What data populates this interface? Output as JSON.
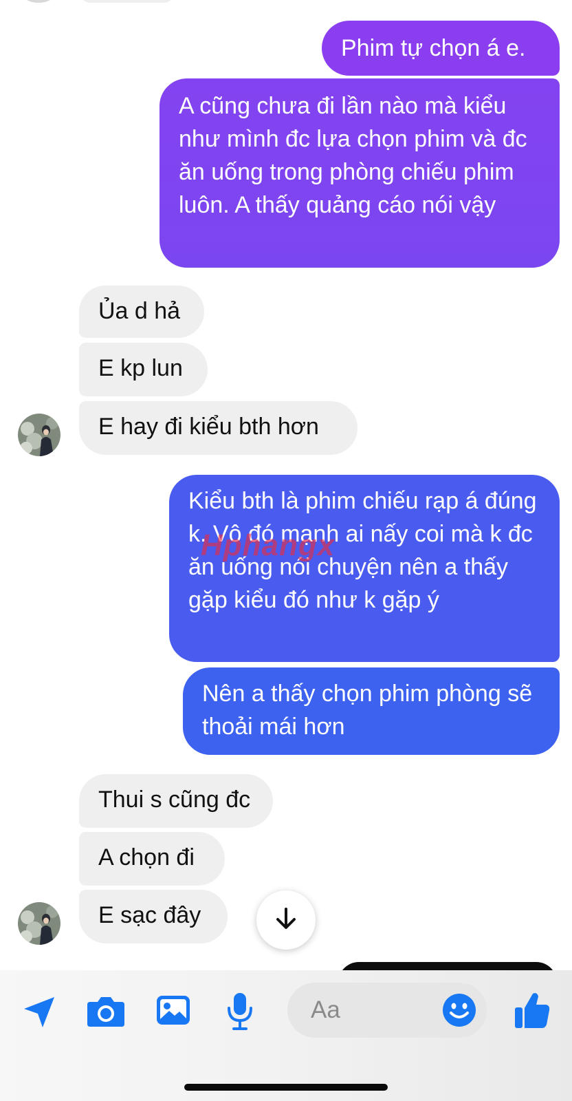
{
  "conversation": {
    "messages": [
      {
        "sender": "me",
        "text": "Phim tự chọn á e."
      },
      {
        "sender": "me",
        "text": "A cũng chưa đi lần nào mà kiểu như mình đc lựa chọn phim và đc ăn uống trong phòng chiếu phim luôn. A thấy quảng cáo nói vậy"
      },
      {
        "sender": "them",
        "text": "Ủa d hả"
      },
      {
        "sender": "them",
        "text": "E kp lun"
      },
      {
        "sender": "them",
        "text": "E hay đi kiểu bth hơn"
      },
      {
        "sender": "me",
        "text": "Kiểu bth là phim chiếu rạp á đúng k. Vô đó mạnh ai nấy coi mà k đc ăn uống nói chuyện nên a thấy gặp kiểu đó như k gặp ý"
      },
      {
        "sender": "me",
        "text": "Nên a thấy chọn phim phòng sẽ thoải mái hơn"
      },
      {
        "sender": "them",
        "text": "Thui s cũng đc"
      },
      {
        "sender": "them",
        "text": "A chọn đi"
      },
      {
        "sender": "them",
        "text": "E sạc đây"
      }
    ]
  },
  "watermark": {
    "text": "Hphangx"
  },
  "composer": {
    "placeholder": "Aa",
    "icons": [
      "send-location-icon",
      "camera-icon",
      "image-icon",
      "microphone-icon",
      "emoji-icon",
      "thumbs-up-icon"
    ]
  },
  "colors": {
    "accent": "#1877f2",
    "outgoing_purple": "#7b3df0",
    "outgoing_blue": "#3f5ff0",
    "incoming": "#efefef"
  }
}
